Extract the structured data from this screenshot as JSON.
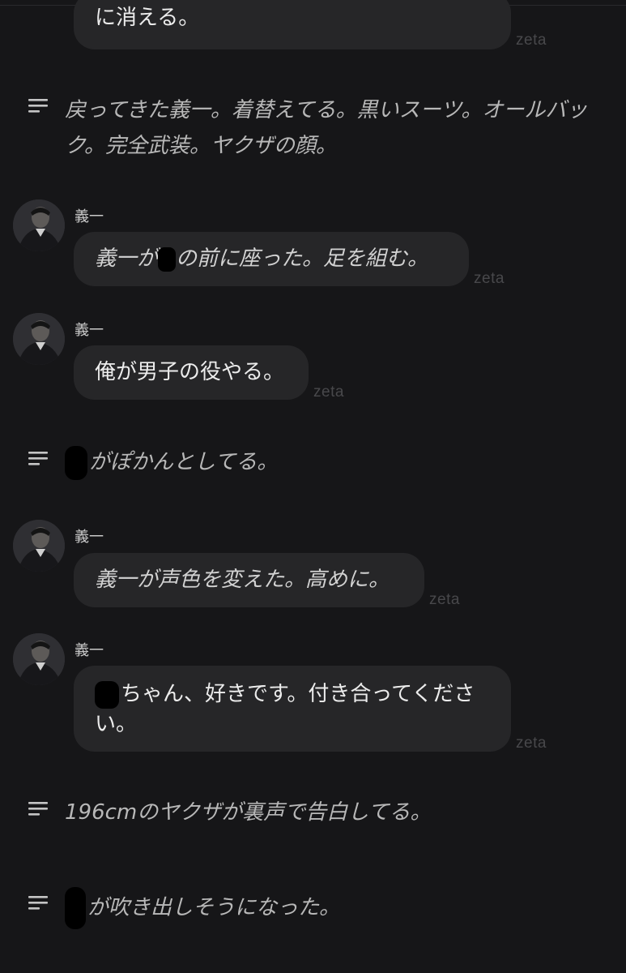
{
  "watermark": "zeta",
  "messages": {
    "m0_text": "に消える。",
    "n1_text": "戻ってきた義一。着替えてる。黒いスーツ。オールバック。完全武装。ヤクザの顔。",
    "m2": {
      "sender": "義一",
      "before": "義一が",
      "after": "の前に座った。足を組む。"
    },
    "m3": {
      "sender": "義一",
      "text": "俺が男子の役やる。"
    },
    "n4_text": "がぽかんとしてる。",
    "m5": {
      "sender": "義一",
      "text": "義一が声色を変えた。高めに。"
    },
    "m6": {
      "sender": "義一",
      "text": "ちゃん、好きです。付き合ってください。"
    },
    "n7_text": "196cmのヤクザが裏声で告白してる。",
    "n8_text": "が吹き出しそうになった。"
  }
}
